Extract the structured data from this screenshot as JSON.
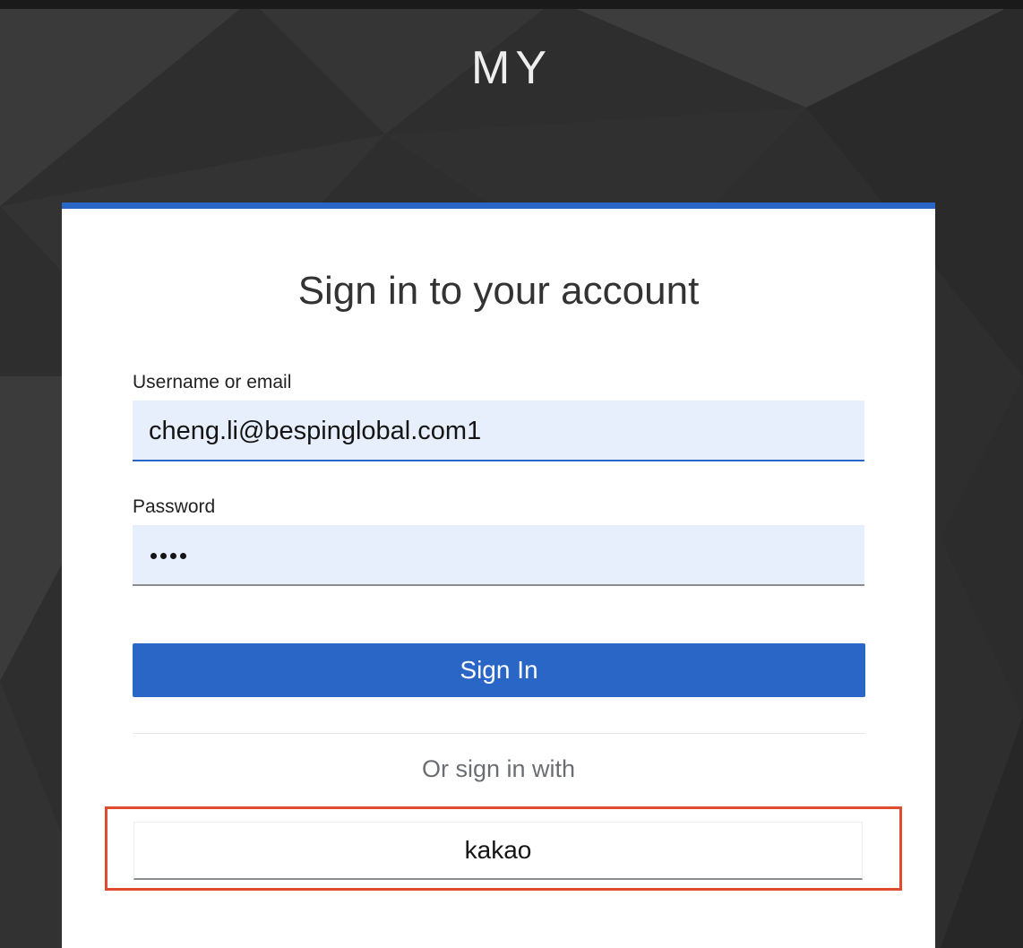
{
  "realm": {
    "title": "MY"
  },
  "login": {
    "heading": "Sign in to your account",
    "username_label": "Username or email",
    "username_value": "cheng.li@bespinglobal.com1",
    "password_label": "Password",
    "password_masked": "••••",
    "submit_label": "Sign In",
    "social_divider_text": "Or sign in with",
    "providers": [
      {
        "label": "kakao"
      }
    ]
  },
  "colors": {
    "accent": "#2a66c6",
    "input_bg": "#e8effc",
    "highlight": "#e04a2f"
  }
}
